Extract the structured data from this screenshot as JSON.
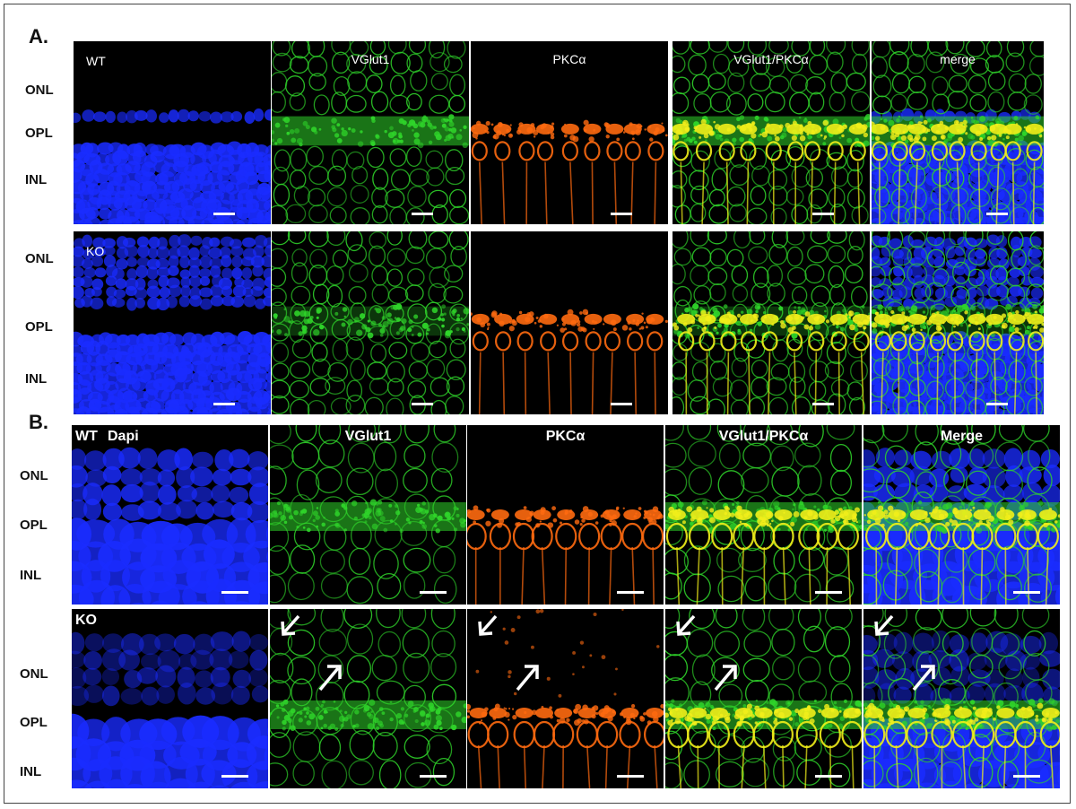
{
  "figure": {
    "panel_a_label": "A.",
    "panel_b_label": "B.",
    "layer_labels": [
      "ONL",
      "OPL",
      "INL"
    ],
    "a_rows": [
      {
        "row_label": "WT",
        "titles": [
          "",
          "VGlut1",
          "PKCα",
          "VGlut1/PKCα",
          "merge"
        ]
      },
      {
        "row_label": "KO",
        "titles": [
          "",
          "",
          "",
          "",
          ""
        ]
      }
    ],
    "b_rows": [
      {
        "row_label": "WT",
        "titles": [
          "Dapi",
          "VGlut1",
          "PKCα",
          "VGlut1/PKCα",
          "Merge"
        ]
      },
      {
        "row_label": "KO",
        "titles": [
          "",
          "",
          "",
          "",
          ""
        ]
      }
    ],
    "channel_colors": {
      "dapi": "#1a2cff",
      "vglut1": "#2fd42a",
      "pkc": "#ff6a10",
      "overlap": "#f2ef1a",
      "background": "#000000"
    }
  }
}
